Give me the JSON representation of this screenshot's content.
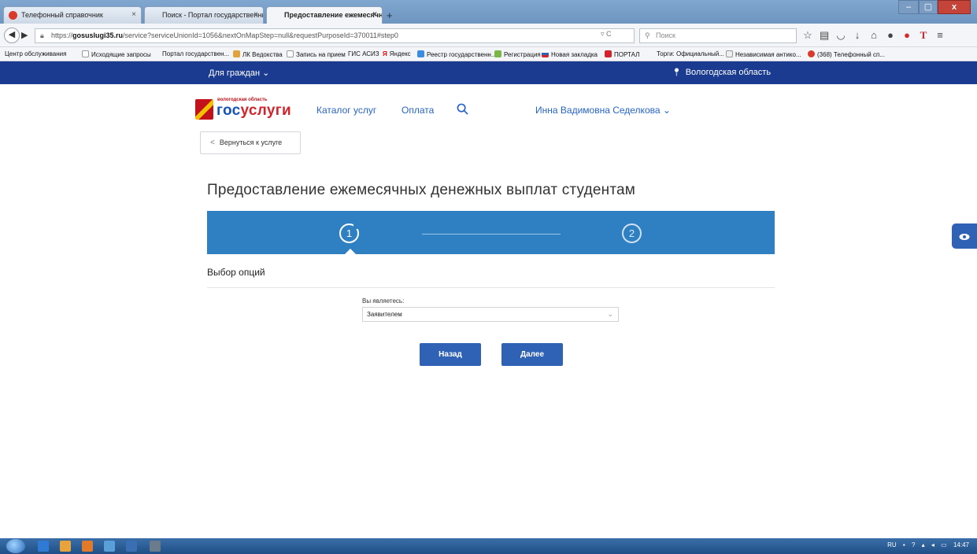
{
  "browser": {
    "tabs": [
      {
        "label": "Телефонный справочник",
        "icon": "clock-icon"
      },
      {
        "label": "Поиск - Портал государственны...",
        "icon": "page-icon"
      },
      {
        "label": "Предоставление ежемесячны...",
        "icon": "page-icon"
      }
    ],
    "new_tab": "+",
    "url_prefix": "https://",
    "url_host": "gosuslugi35.ru",
    "url_rest": "/service?serviceUnionId=1056&nextOnMapStep=null&requestPurposeId=370011#step0",
    "search_placeholder": "Поиск",
    "bookmarks": [
      "Центр обслуживания",
      "Исходящие запросы",
      "Портал государствен...",
      "ЛК Ведокства",
      "Запись на прием",
      "ГИС АСИЗ",
      "Яндекс",
      "Реестр государственн...",
      "Регистрация",
      "Новая закладка",
      "ПОРТАЛ",
      "Торги: Официальный...",
      "Независимая антико...",
      "(368) Телефонный сп..."
    ]
  },
  "site": {
    "top_menu": "Для граждан",
    "region": "Вологодская область",
    "logo_region": "вологодская область",
    "logo_text_main": "гос",
    "logo_text_accent": "услуги",
    "nav": {
      "catalog": "Каталог услуг",
      "payment": "Оплата",
      "user": "Инна Вадимовна Седелкова"
    },
    "back_to_service": "Вернуться к услуге",
    "page_title": "Предоставление ежемесячных денежных выплат студентам",
    "steps": [
      "1",
      "2"
    ],
    "current_step": 1,
    "section_title": "Выбор опций",
    "form": {
      "label": "Вы являетесь:",
      "selected": "Заявителем"
    },
    "buttons": {
      "back": "Назад",
      "next": "Далее"
    }
  },
  "taskbar": {
    "lang": "RU",
    "time": "14:47"
  },
  "colors": {
    "header_bar": "#1a3b8f",
    "stepper": "#2f80c3",
    "primary_button": "#2f62b5",
    "link": "#2764c9"
  }
}
